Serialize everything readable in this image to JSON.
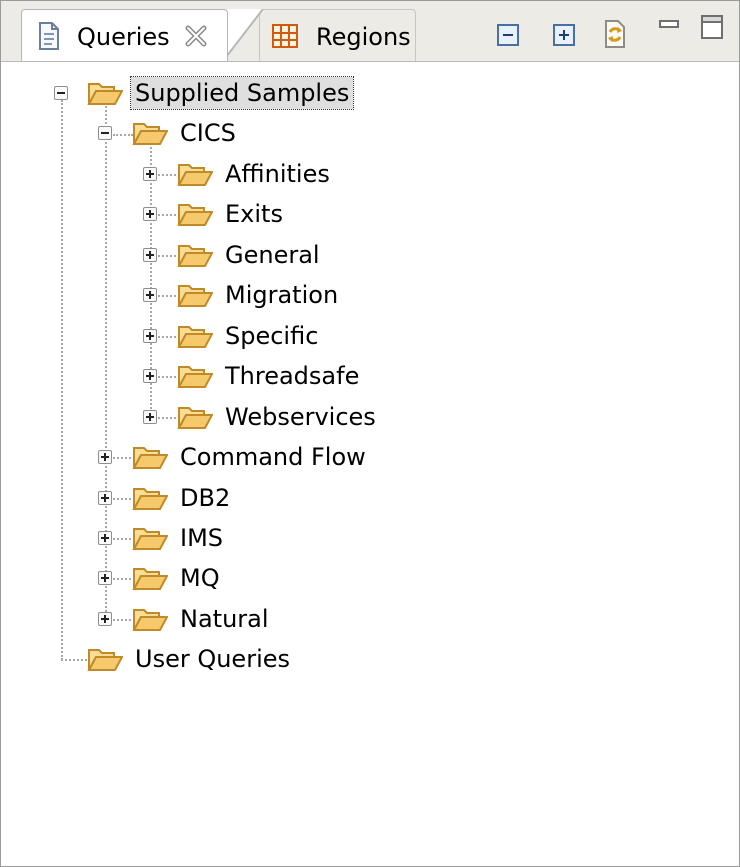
{
  "tabs": [
    {
      "label": "Queries",
      "active": true,
      "icon": "document-icon"
    },
    {
      "label": "Regions",
      "active": false,
      "icon": "regions-grid-icon"
    }
  ],
  "toolbar": {
    "collapse_all_icon": "collapse-all-icon",
    "expand_all_icon": "expand-all-icon",
    "refresh_icon": "refresh-icon",
    "minimize_icon": "minimize-icon",
    "maximize_icon": "maximize-icon"
  },
  "tree": {
    "root": {
      "label": "Supplied Samples",
      "expanded": true,
      "selected": true
    },
    "cics": {
      "label": "CICS",
      "expanded": true
    },
    "cics_children": [
      "Affinities",
      "Exits",
      "General",
      "Migration",
      "Specific",
      "Threadsafe",
      "Webservices"
    ],
    "samples_children": [
      "Command Flow",
      "DB2",
      "IMS",
      "MQ",
      "Natural"
    ],
    "user_queries": {
      "label": "User Queries"
    }
  },
  "colors": {
    "folder_fill": "#f6c96c",
    "folder_stroke": "#c08a28",
    "tab_background": "#ecebe6",
    "selection_background": "#dfdfdf"
  }
}
